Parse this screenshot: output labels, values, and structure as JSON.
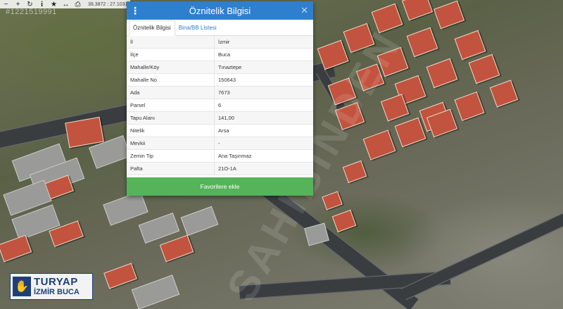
{
  "toolbar": {
    "buttons": [
      {
        "icon": "zoom-out-icon"
      },
      {
        "icon": "zoom-in-icon"
      },
      {
        "icon": "refresh-icon"
      },
      {
        "icon": "info-icon"
      },
      {
        "icon": "star-icon"
      },
      {
        "icon": "measure-icon"
      },
      {
        "icon": "print-icon"
      }
    ],
    "coordinates": "38.3872 : 27.1031"
  },
  "map": {
    "reference_number": "#1221519991",
    "watermark": "SAHIBINDEN"
  },
  "logo": {
    "line1": "TURYAP",
    "line2": "İZMİR BUCA"
  },
  "dialog": {
    "title": "Öznitelik Bilgisi",
    "tabs": [
      {
        "label": "Öznitelik Bilgisi",
        "active": true
      },
      {
        "label": "Bina/BB Listesi",
        "active": false
      }
    ],
    "rows": [
      {
        "key": "İl",
        "value": "İzmir"
      },
      {
        "key": "İlçe",
        "value": "Buca"
      },
      {
        "key": "Mahalle/Köy",
        "value": "Tınaztepe"
      },
      {
        "key": "Mahalle No",
        "value": "150643"
      },
      {
        "key": "Ada",
        "value": "7673"
      },
      {
        "key": "Parsel",
        "value": "6"
      },
      {
        "key": "Tapu Alanı",
        "value": "141,00"
      },
      {
        "key": "Nitelik",
        "value": "Arsa"
      },
      {
        "key": "Mevkii",
        "value": "-"
      },
      {
        "key": "Zemin Tip",
        "value": "Ana Taşınmaz"
      },
      {
        "key": "Pafta",
        "value": "21O-1A"
      }
    ],
    "favorite_button": "Favorilere ekle",
    "colors": {
      "header": "#2f7fcf",
      "button": "#55b35a"
    }
  }
}
